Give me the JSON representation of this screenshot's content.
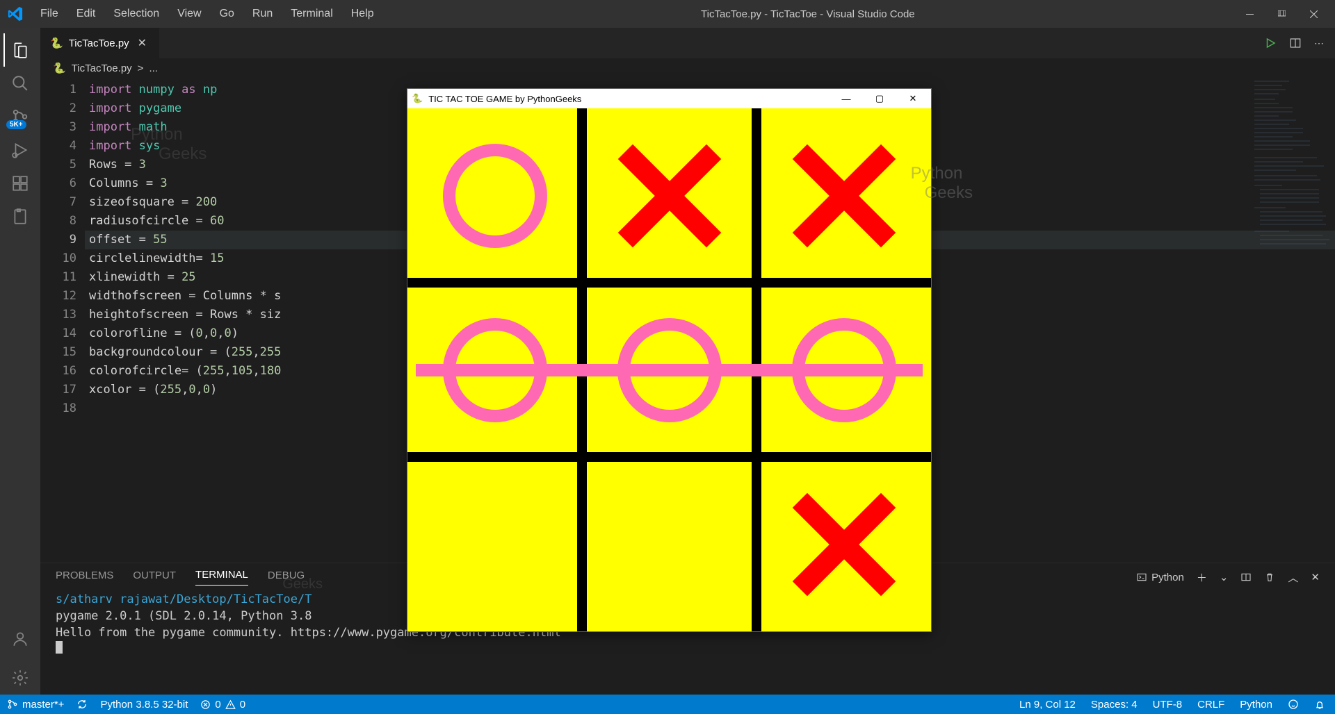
{
  "window": {
    "title": "TicTacToe.py - TicTacToe - Visual Studio Code"
  },
  "menu": {
    "file": "File",
    "edit": "Edit",
    "selection": "Selection",
    "view": "View",
    "go": "Go",
    "run": "Run",
    "terminal": "Terminal",
    "help": "Help"
  },
  "activity": {
    "badge_source": "5K+"
  },
  "tab": {
    "filename": "TicTacToe.py"
  },
  "breadcrumb": {
    "file": "TicTacToe.py",
    "sep": ">",
    "more": "..."
  },
  "code": {
    "lines": [
      {
        "n": "1",
        "html": "<span class='kw'>import</span> <span class='mod'>numpy</span> <span class='kw'>as</span> <span class='mod'>np</span>"
      },
      {
        "n": "2",
        "html": "<span class='kw'>import</span> <span class='mod'>pygame</span>"
      },
      {
        "n": "3",
        "html": "<span class='kw'>import</span> <span class='mod'>math</span>"
      },
      {
        "n": "4",
        "html": "<span class='kw'>import</span> <span class='mod'>sys</span>"
      },
      {
        "n": "5",
        "html": "Rows = <span class='num'>3</span>"
      },
      {
        "n": "6",
        "html": "Columns = <span class='num'>3</span>"
      },
      {
        "n": "7",
        "html": "sizeofsquare = <span class='num'>200</span>"
      },
      {
        "n": "8",
        "html": "radiusofcircle = <span class='num'>60</span>"
      },
      {
        "n": "9",
        "html": "offset = <span class='num'>55</span>"
      },
      {
        "n": "10",
        "html": "circlelinewidth= <span class='num'>15</span>"
      },
      {
        "n": "11",
        "html": "xlinewidth = <span class='num'>25</span>"
      },
      {
        "n": "12",
        "html": "widthofscreen = Columns * s"
      },
      {
        "n": "13",
        "html": "heightofscreen = Rows * siz"
      },
      {
        "n": "14",
        "html": "colorofline = (<span class='num'>0</span>,<span class='num'>0</span>,<span class='num'>0</span>)"
      },
      {
        "n": "15",
        "html": "backgroundcolour = (<span class='num'>255</span>,<span class='num'>255</span>"
      },
      {
        "n": "16",
        "html": "colorofcircle= (<span class='num'>255</span>,<span class='num'>105</span>,<span class='num'>180</span>"
      },
      {
        "n": "17",
        "html": "xcolor = (<span class='num'>255</span>,<span class='num'>0</span>,<span class='num'>0</span>)"
      },
      {
        "n": "18",
        "html": ""
      }
    ]
  },
  "panel": {
    "tabs": {
      "problems": "PROBLEMS",
      "output": "OUTPUT",
      "terminal": "TERMINAL",
      "debug": "DEBUG"
    },
    "kind": "Python",
    "output_path": "s/atharv rajawat/Desktop/TicTacToe/T",
    "output_line2": "pygame 2.0.1 (SDL 2.0.14, Python 3.8",
    "output_line3": "Hello from the pygame community. https://www.pygame.org/contribute.html"
  },
  "status": {
    "branch": "master*+",
    "python": "Python 3.8.5 32-bit",
    "errors": "0",
    "warnings": "0",
    "position": "Ln 9, Col 12",
    "spaces": "Spaces: 4",
    "encoding": "UTF-8",
    "eol": "CRLF",
    "language": "Python"
  },
  "pygame": {
    "title": "TIC TAC TOE GAME by PythonGeeks",
    "board": [
      [
        "O",
        "X",
        "X"
      ],
      [
        "O",
        "O",
        "O"
      ],
      [
        "",
        "",
        "X"
      ]
    ],
    "win_row_index": 1
  },
  "watermark1": "Python",
  "watermark2": "Geeks",
  "watermark3": "Python",
  "watermark4": "Geeks"
}
